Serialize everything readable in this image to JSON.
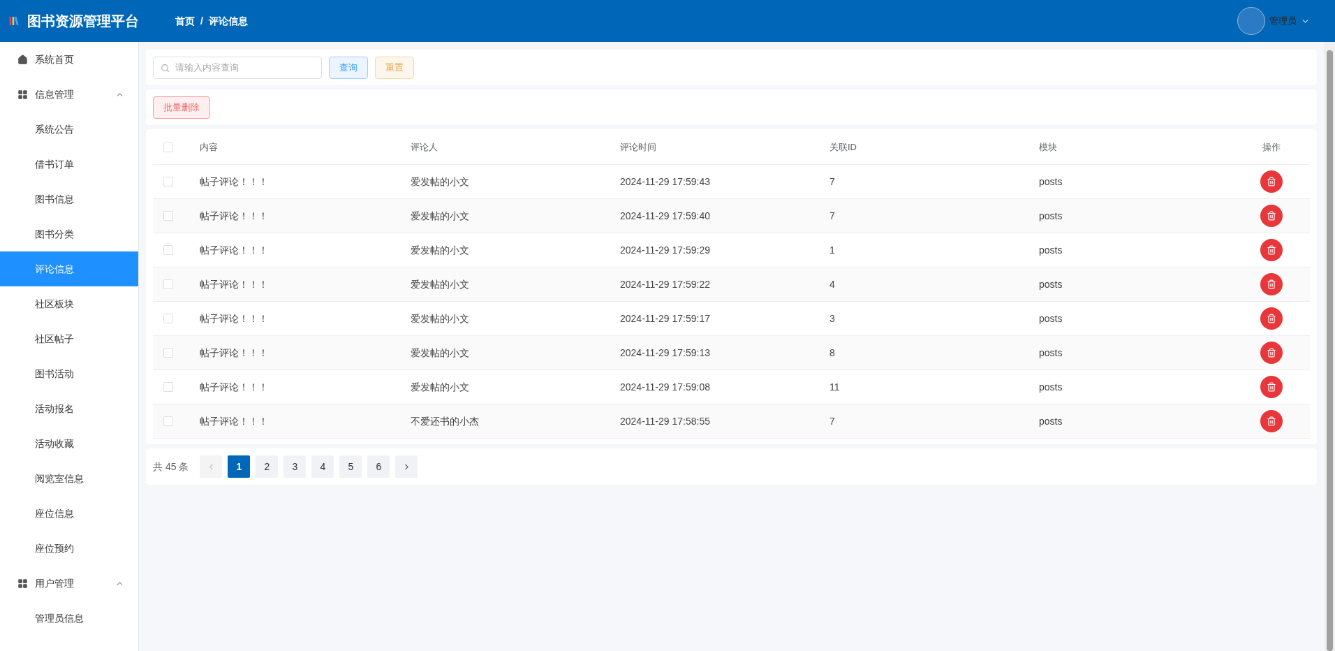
{
  "header": {
    "title": "图书资源管理平台",
    "breadcrumb": [
      "首页",
      "评论信息"
    ],
    "separator": "/",
    "user": "管理员"
  },
  "sidebar": {
    "items": [
      {
        "kind": "item",
        "label": "系统首页",
        "selected": false
      },
      {
        "kind": "group",
        "label": "信息管理",
        "expanded": true,
        "children": [
          {
            "label": "系统公告",
            "selected": false
          },
          {
            "label": "借书订单",
            "selected": false
          },
          {
            "label": "图书信息",
            "selected": false
          },
          {
            "label": "图书分类",
            "selected": false
          },
          {
            "label": "评论信息",
            "selected": true
          },
          {
            "label": "社区板块",
            "selected": false
          },
          {
            "label": "社区帖子",
            "selected": false
          },
          {
            "label": "图书活动",
            "selected": false
          },
          {
            "label": "活动报名",
            "selected": false
          },
          {
            "label": "活动收藏",
            "selected": false
          },
          {
            "label": "阅览室信息",
            "selected": false
          },
          {
            "label": "座位信息",
            "selected": false
          },
          {
            "label": "座位预约",
            "selected": false
          }
        ]
      },
      {
        "kind": "group",
        "label": "用户管理",
        "expanded": true,
        "children": [
          {
            "label": "管理员信息",
            "selected": false
          }
        ]
      }
    ]
  },
  "search": {
    "placeholder": "请输入内容查询",
    "buttons": [
      "查询",
      "重置"
    ]
  },
  "batch_delete": "批量删除",
  "table": {
    "select_all": false,
    "columns": [
      "内容",
      "评论人",
      "评论时间",
      "关联ID",
      "模块",
      "操作"
    ],
    "rows": [
      {
        "checked": false,
        "cells": [
          "帖子评论！！！",
          "爱发帖的小文",
          "2024-11-29 17:59:43",
          "7",
          "posts"
        ]
      },
      {
        "checked": false,
        "cells": [
          "帖子评论！！！",
          "爱发帖的小文",
          "2024-11-29 17:59:40",
          "7",
          "posts"
        ]
      },
      {
        "checked": false,
        "cells": [
          "帖子评论！！！",
          "爱发帖的小文",
          "2024-11-29 17:59:29",
          "1",
          "posts"
        ]
      },
      {
        "checked": false,
        "cells": [
          "帖子评论！！！",
          "爱发帖的小文",
          "2024-11-29 17:59:22",
          "4",
          "posts"
        ]
      },
      {
        "checked": false,
        "cells": [
          "帖子评论！！！",
          "爱发帖的小文",
          "2024-11-29 17:59:17",
          "3",
          "posts"
        ]
      },
      {
        "checked": false,
        "cells": [
          "帖子评论！！！",
          "爱发帖的小文",
          "2024-11-29 17:59:13",
          "8",
          "posts"
        ]
      },
      {
        "checked": false,
        "cells": [
          "帖子评论！！！",
          "爱发帖的小文",
          "2024-11-29 17:59:08",
          "11",
          "posts"
        ]
      },
      {
        "checked": false,
        "cells": [
          "帖子评论！！！",
          "不爱还书的小杰",
          "2024-11-29 17:58:55",
          "7",
          "posts"
        ]
      }
    ]
  },
  "pagination": {
    "total": "共 45 条",
    "pages": [
      {
        "label": "1",
        "selected": true
      },
      {
        "label": "2",
        "selected": false
      },
      {
        "label": "3",
        "selected": false
      },
      {
        "label": "4",
        "selected": false
      },
      {
        "label": "5",
        "selected": false
      },
      {
        "label": "6",
        "selected": false
      }
    ]
  }
}
